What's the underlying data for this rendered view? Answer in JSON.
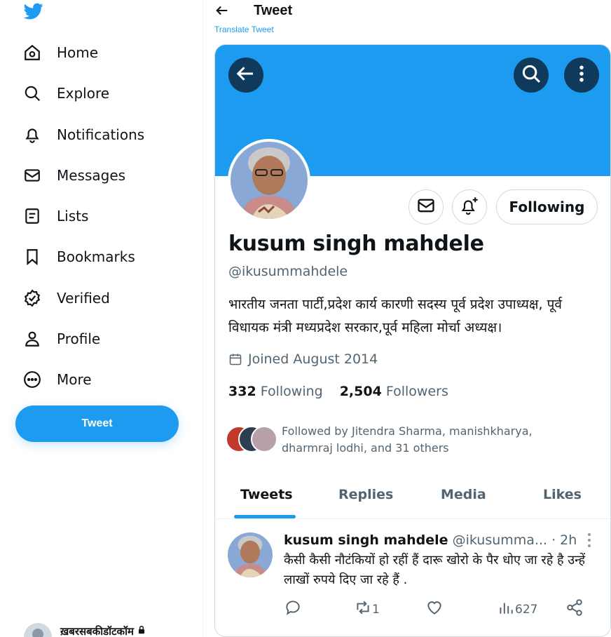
{
  "colors": {
    "accent": "#1d9bf0",
    "banner_button": "#0f3a5b",
    "text": "#0f1419",
    "muted": "#536471"
  },
  "sidebar": {
    "logo_icon": "twitter-bird-icon",
    "items": [
      {
        "label": "Home",
        "icon": "home-icon"
      },
      {
        "label": "Explore",
        "icon": "search-icon"
      },
      {
        "label": "Notifications",
        "icon": "bell-icon"
      },
      {
        "label": "Messages",
        "icon": "envelope-icon"
      },
      {
        "label": "Lists",
        "icon": "list-icon"
      },
      {
        "label": "Bookmarks",
        "icon": "bookmark-icon"
      },
      {
        "label": "Verified",
        "icon": "verified-badge-icon"
      },
      {
        "label": "Profile",
        "icon": "person-icon"
      },
      {
        "label": "More",
        "icon": "more-circle-icon"
      }
    ],
    "tweet_button": "Tweet",
    "account_name": "ख़बरसबकीडॉटकॉम"
  },
  "header": {
    "title": "Tweet",
    "translate_link": "Translate Tweet"
  },
  "profile": {
    "name": "kusum singh mahdele",
    "handle": "@ikusummahdele",
    "bio": "भारतीय जनता पार्टी,प्रदेश कार्य कारणी सदस्य पूर्व प्रदेश उपाध्यक्ष, पूर्व विधायक मंत्री मध्यप्रदेश सरकार,पूर्व महिला मोर्चा अध्यक्ष।",
    "joined": "Joined August 2014",
    "following_count": "332",
    "following_label": "Following",
    "followers_count": "2,504",
    "followers_label": "Followers",
    "followed_by": "Followed by Jitendra Sharma, manishkharya, dharmraj lodhi, and 31 others",
    "follow_button": "Following"
  },
  "tabs": [
    "Tweets",
    "Replies",
    "Media",
    "Likes"
  ],
  "tweet": {
    "author_name": "kusum singh mahdele",
    "author_handle": "@ikusumma...",
    "time": "· 2h",
    "text": "कैसी कैसी नौटंकियों हो रहीं हैं दारू खोरो के पैर धोए जा रहे है उन्हें लाखों रुपये दिए जा रहे हैं .",
    "retweets": "1",
    "views": "627"
  }
}
